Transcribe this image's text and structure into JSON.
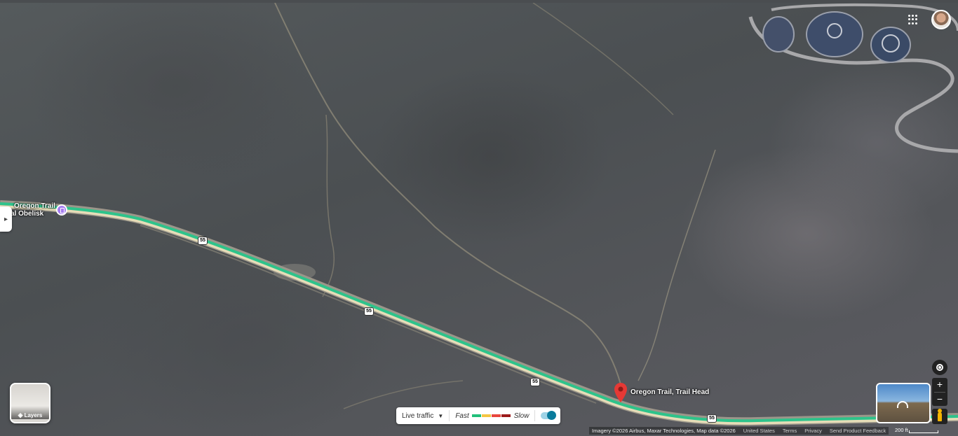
{
  "map": {
    "view": "satellite",
    "poi": {
      "obelisk_line1": "Oregon Trail",
      "obelisk_line2": "nnial Obelisk",
      "trailhead": "Oregon Trail, Trail Head"
    },
    "route_shields": [
      "55",
      "55",
      "55",
      "55"
    ],
    "marker_color": "#e53935",
    "road_color": "#2ec38b"
  },
  "layers": {
    "label": "Layers",
    "icon": "layers-icon"
  },
  "traffic": {
    "label": "Live traffic",
    "fast": "Fast",
    "slow": "Slow",
    "colors": [
      "#21c07a",
      "#f4c542",
      "#e8463d",
      "#9c1b1b"
    ],
    "enabled": true
  },
  "attribution": {
    "imagery": "Imagery ©2026 Airbus, Maxar Technologies, Map data ©2026",
    "region": "United States",
    "terms": "Terms",
    "privacy": "Privacy",
    "feedback": "Send Product Feedback",
    "scale": "200 ft"
  },
  "controls": {
    "zoom_in": "+",
    "zoom_out": "−"
  }
}
